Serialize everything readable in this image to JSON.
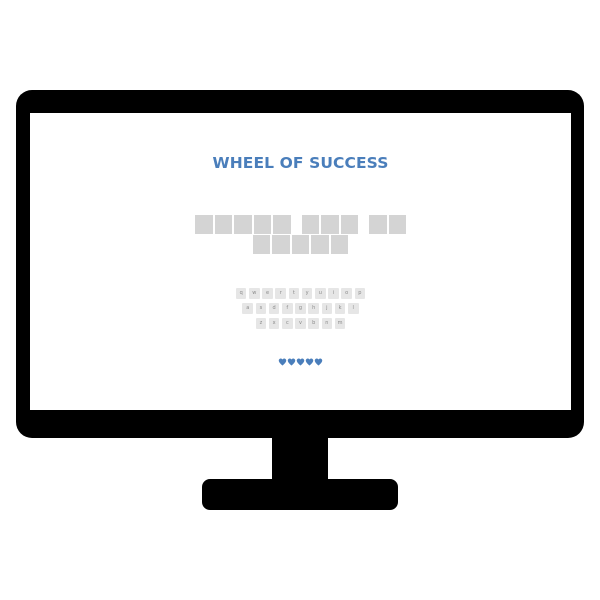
{
  "game": {
    "title": "WHEEL OF SUCCESS"
  },
  "puzzle": {
    "lines": [
      {
        "words": [
          5,
          3,
          2
        ]
      },
      {
        "words": [
          5
        ]
      }
    ],
    "revealed_letters": []
  },
  "keyboard": {
    "rows": [
      [
        "q",
        "w",
        "e",
        "r",
        "t",
        "y",
        "u",
        "i",
        "o",
        "p"
      ],
      [
        "a",
        "s",
        "d",
        "f",
        "g",
        "h",
        "j",
        "k",
        "l"
      ],
      [
        "z",
        "x",
        "c",
        "v",
        "b",
        "n",
        "m"
      ]
    ]
  },
  "lives": {
    "remaining": 5,
    "icon": "heart-icon"
  },
  "colors": {
    "title": "#4a7ebb",
    "heart": "#4a7ebb",
    "tile": "#d4d4d4",
    "key": "#e6e6e6",
    "bezel": "#000000",
    "screen": "#ffffff"
  }
}
